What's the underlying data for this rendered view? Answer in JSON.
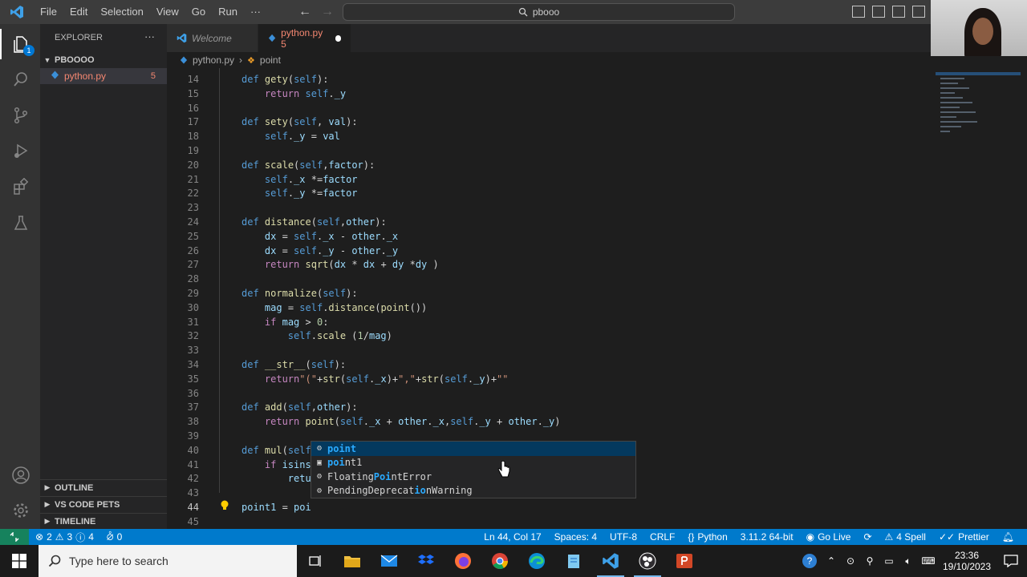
{
  "menu": [
    "File",
    "Edit",
    "Selection",
    "View",
    "Go",
    "Run",
    "···"
  ],
  "command_center": "pbooo",
  "explorer": {
    "title": "EXPLORER",
    "more": "···",
    "folder": "PBOOOO",
    "file": {
      "name": "python.py",
      "problems": "5"
    },
    "sections": [
      "OUTLINE",
      "VS CODE PETS",
      "TIMELINE"
    ]
  },
  "tabs": [
    {
      "label": "Welcome"
    },
    {
      "label": "python.py 5"
    }
  ],
  "breadcrumb": {
    "file": "python.py",
    "symbol": "point"
  },
  "code_lines": [
    {
      "n": "14",
      "t": "    def gety(self):"
    },
    {
      "n": "15",
      "t": "        return self._y"
    },
    {
      "n": "16",
      "t": ""
    },
    {
      "n": "17",
      "t": "    def sety(self, val):"
    },
    {
      "n": "18",
      "t": "        self._y = val"
    },
    {
      "n": "19",
      "t": ""
    },
    {
      "n": "20",
      "t": "    def scale(self,factor):"
    },
    {
      "n": "21",
      "t": "        self._x *=factor"
    },
    {
      "n": "22",
      "t": "        self._y *=factor"
    },
    {
      "n": "23",
      "t": ""
    },
    {
      "n": "24",
      "t": "    def distance(self,other):"
    },
    {
      "n": "25",
      "t": "        dx = self._x - other._x"
    },
    {
      "n": "26",
      "t": "        dx = self._y - other._y"
    },
    {
      "n": "27",
      "t": "        return sqrt(dx * dx + dy *dy )"
    },
    {
      "n": "28",
      "t": ""
    },
    {
      "n": "29",
      "t": "    def normalize(self):"
    },
    {
      "n": "30",
      "t": "        mag = self.distance(point())"
    },
    {
      "n": "31",
      "t": "        if mag > 0:"
    },
    {
      "n": "32",
      "t": "            self.scale (1/mag)"
    },
    {
      "n": "33",
      "t": ""
    },
    {
      "n": "34",
      "t": "    def __str__(self):"
    },
    {
      "n": "35",
      "t": "        return\"(\"+str(self._x)+\",\"+str(self._y)+\"\""
    },
    {
      "n": "36",
      "t": ""
    },
    {
      "n": "37",
      "t": "    def add(self,other):"
    },
    {
      "n": "38",
      "t": "        return point(self._x + other._x,self._y + other._y)"
    },
    {
      "n": "39",
      "t": ""
    },
    {
      "n": "40",
      "t": "    def mul(self"
    },
    {
      "n": "41",
      "t": "        if isins"
    },
    {
      "n": "42",
      "t": "            retu"
    },
    {
      "n": "43",
      "t": ""
    },
    {
      "n": "44",
      "t": "point1 = poi"
    },
    {
      "n": "45",
      "t": ""
    }
  ],
  "suggestions": [
    {
      "icon": "class-icon",
      "pre": "",
      "match": "point",
      "post": ""
    },
    {
      "icon": "variable-icon",
      "pre": "",
      "match": "poi",
      "post": "nt1"
    },
    {
      "icon": "class-icon",
      "pre": "Floating",
      "match": "Poi",
      "post": "ntError"
    },
    {
      "icon": "class-icon",
      "pre": "PendingDeprecat",
      "match": "io",
      "post": "nWarning"
    }
  ],
  "status": {
    "errors": "2",
    "warnings": "3",
    "info": "4",
    "ports": "0",
    "position": "Ln 44, Col 17",
    "spaces": "Spaces: 4",
    "encoding": "UTF-8",
    "eol": "CRLF",
    "language": "Python",
    "interpreter": "3.11.2 64-bit",
    "golive": "Go Live",
    "spell": "4 Spell",
    "prettier": "Prettier"
  },
  "taskbar": {
    "search_placeholder": "Type here to search",
    "time": "23:36",
    "date": "19/10/2023"
  },
  "colors": {
    "accent": "#007acc",
    "error_file": "#f48771",
    "remote": "#16825d"
  }
}
